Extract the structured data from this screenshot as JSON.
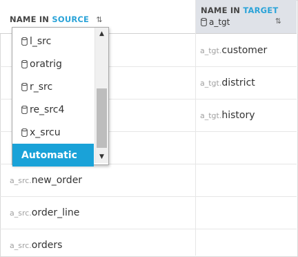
{
  "header": {
    "source": {
      "label_prefix": "NAME IN",
      "label_accent": "SOURCE",
      "sort_glyph": "⇅"
    },
    "target": {
      "label_prefix": "NAME IN",
      "label_accent": "TARGET",
      "schema": "a_tgt",
      "sort_glyph": "⇅"
    }
  },
  "rows": [
    {
      "src_prefix": "",
      "src_name": "",
      "tgt_prefix": "a_tgt.",
      "tgt_name": "customer"
    },
    {
      "src_prefix": "",
      "src_name": "",
      "tgt_prefix": "a_tgt.",
      "tgt_name": "district"
    },
    {
      "src_prefix": "",
      "src_name": "",
      "tgt_prefix": "a_tgt.",
      "tgt_name": "history"
    },
    {
      "src_prefix": "",
      "src_name": "",
      "tgt_prefix": "",
      "tgt_name": ""
    },
    {
      "src_prefix": "a_src.",
      "src_name": "new_order",
      "tgt_prefix": "",
      "tgt_name": ""
    },
    {
      "src_prefix": "a_src.",
      "src_name": "order_line",
      "tgt_prefix": "",
      "tgt_name": ""
    },
    {
      "src_prefix": "a_src.",
      "src_name": "orders",
      "tgt_prefix": "",
      "tgt_name": ""
    }
  ],
  "dropdown": {
    "options": [
      "l_src",
      "oratrig",
      "r_src",
      "re_src4",
      "x_srcu"
    ],
    "selected": "Automatic",
    "scroll_up_glyph": "▲",
    "scroll_down_glyph": "▼"
  },
  "colors": {
    "accent": "#2aa3d8",
    "selected_bg": "#1aa2d8",
    "header_target_bg": "#dfe2e8"
  },
  "icons": {
    "schema": "database-icon",
    "sort": "sort-icon"
  }
}
